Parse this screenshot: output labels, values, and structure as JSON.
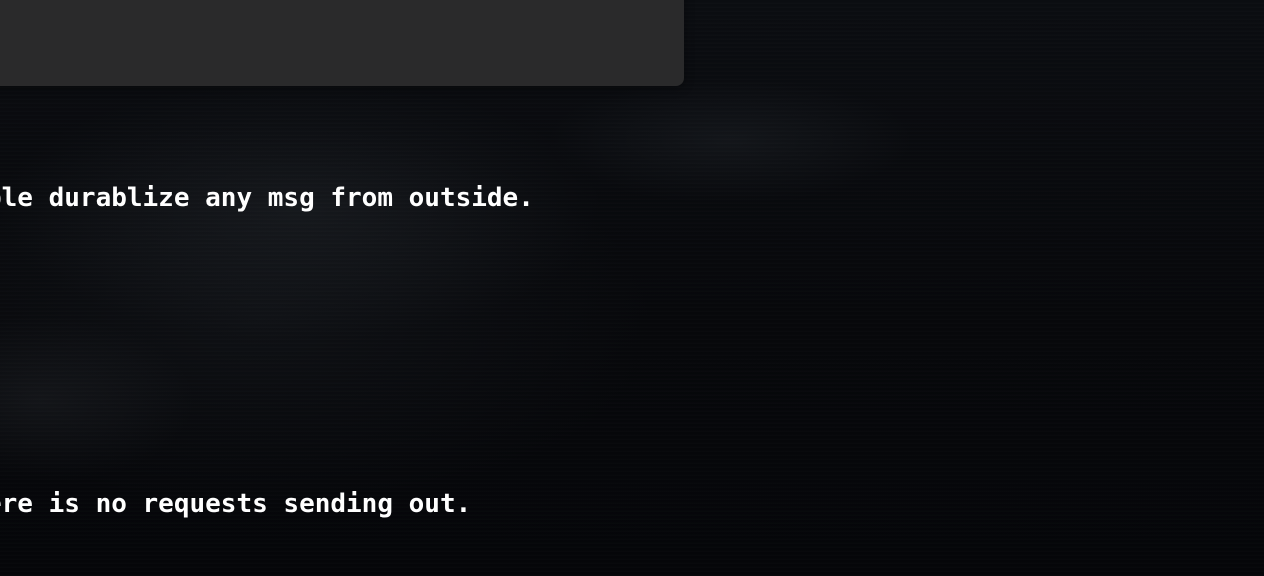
{
  "terminal": {
    "lines": [
      "ble durablize any msg from outside.",
      "ere is no requests sending out."
    ]
  }
}
